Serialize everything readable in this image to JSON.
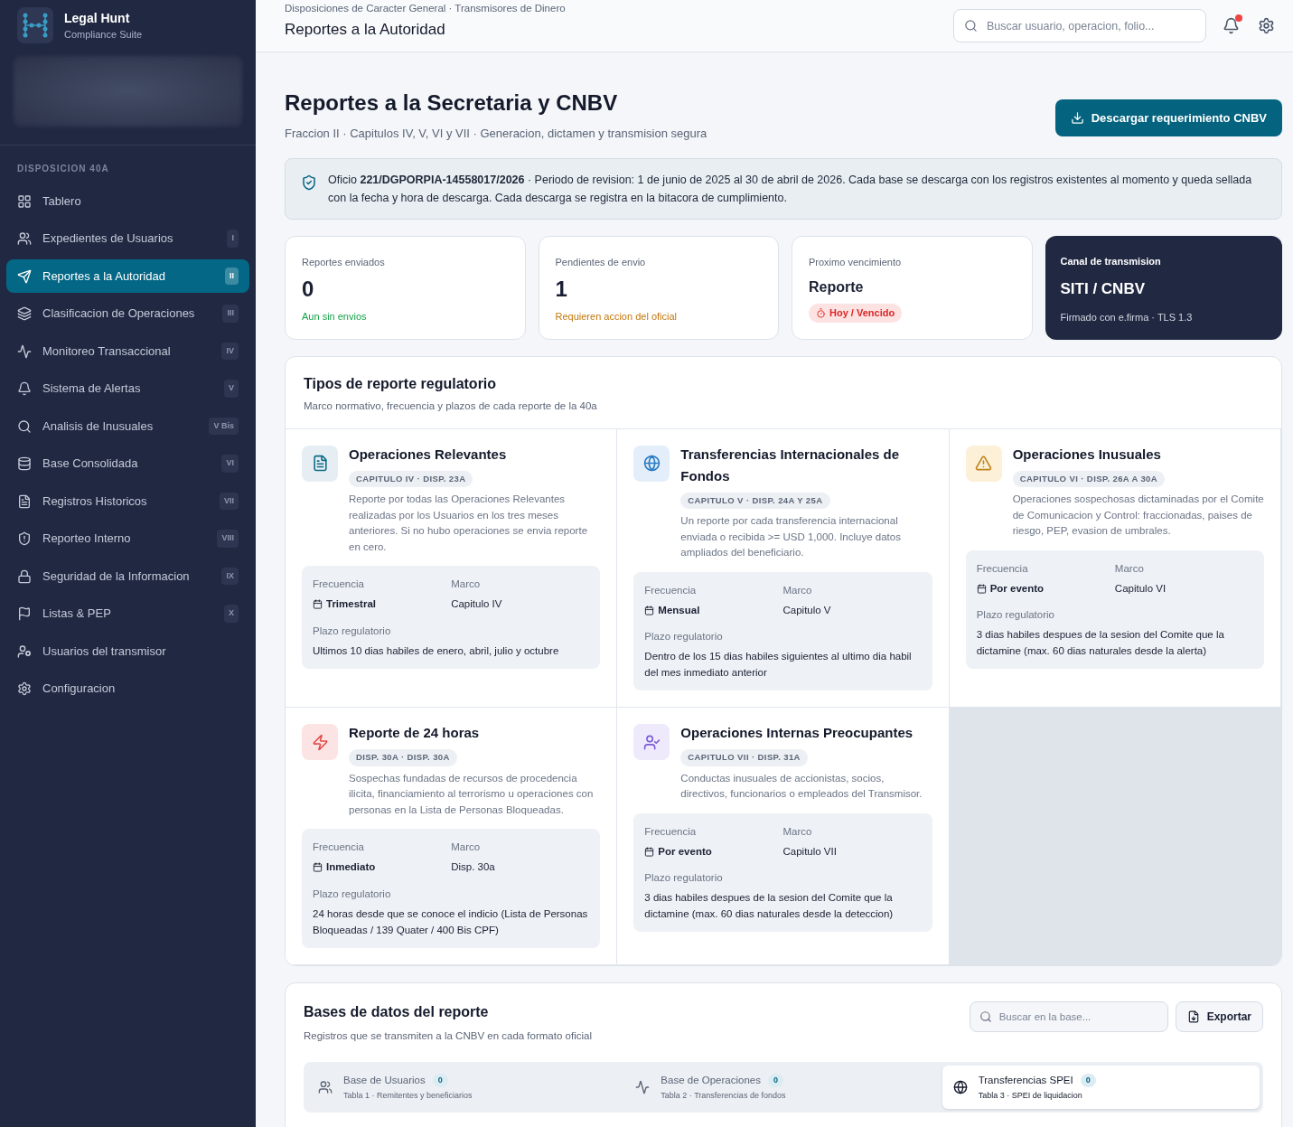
{
  "brand": {
    "name": "Legal Hunt",
    "subtitle": "Compliance Suite"
  },
  "sidebar": {
    "section": "DISPOSICION 40A",
    "items": [
      {
        "kind": "grid",
        "label": "Tablero",
        "selected": false
      },
      {
        "kind": "users",
        "label": "Expedientes de Usuarios",
        "badge": "I",
        "selected": false
      },
      {
        "kind": "send",
        "label": "Reportes a la Autoridad",
        "badge": "II",
        "selected": true
      },
      {
        "kind": "layers",
        "label": "Clasificacion de Operaciones",
        "badge": "III",
        "selected": false
      },
      {
        "kind": "pulse",
        "label": "Monitoreo Transaccional",
        "badge": "IV",
        "selected": false
      },
      {
        "kind": "bell",
        "label": "Sistema de Alertas",
        "badge": "V",
        "selected": false
      },
      {
        "kind": "search",
        "label": "Analisis de Inusuales",
        "badge": "V Bis",
        "selected": false
      },
      {
        "kind": "db",
        "label": "Base Consolidada",
        "badge": "VI",
        "selected": false
      },
      {
        "kind": "file",
        "label": "Registros Historicos",
        "badge": "VII",
        "selected": false
      },
      {
        "kind": "shield",
        "label": "Reporteo Interno",
        "badge": "VIII",
        "selected": false
      },
      {
        "kind": "lock",
        "label": "Seguridad de la Informacion",
        "badge": "IX",
        "selected": false
      },
      {
        "kind": "flag",
        "label": "Listas & PEP",
        "badge": "X",
        "selected": false
      },
      {
        "kind": "usercog",
        "label": "Usuarios del transmisor",
        "selected": false
      },
      {
        "kind": "gear",
        "label": "Configuracion",
        "selected": false
      }
    ]
  },
  "header": {
    "breadcrumb": "Disposiciones de Caracter General · Transmisores de Dinero",
    "title": "Reportes a la Autoridad",
    "search": {
      "placeholder": "Buscar usuario, operacion, folio..."
    },
    "notifications_unread": true
  },
  "page": {
    "title": "Reportes a la Secretaria y CNBV",
    "subtitle": "Fraccion II · Capitulos IV, V, VI y VII · Generacion, dictamen y transmision segura",
    "action": "Descargar requerimiento CNBV",
    "notice": "Oficio **221/DGPORPIA-14558017/2026** · Periodo de revision: 1 de junio de 2025 al 30 de abril de 2026. Cada base se descarga con los registros existentes al momento y queda sellada con la fecha y hora de descarga. Cada descarga se registra en la bitacora de cumplimiento."
  },
  "stats": [
    {
      "kind": "done",
      "label": "Reportes enviados",
      "value": "0",
      "note": "Aun sin envios"
    },
    {
      "kind": "pending",
      "label": "Pendientes de envio",
      "value": "1",
      "note": "Requieren accion del oficial"
    },
    {
      "kind": "due",
      "label": "Proximo vencimiento",
      "value": "Reporte",
      "badge": "Hoy / Vencido"
    },
    {
      "kind": "channel",
      "label": "Canal de transmision",
      "value": "SITI / CNBV",
      "note": "Firmado con e.firma · TLS 1.3"
    }
  ],
  "report_types": {
    "title": "Tipos de reporte regulatorio",
    "subtitle": "Marco normativo, frecuencia y plazos de cada reporte de la 40a",
    "items": [
      {
        "kind": "document",
        "color": "#0e6a86",
        "title": "Operaciones Relevantes",
        "tag": "CAPITULO IV · DISP. 23A",
        "description": "Reporte por todas las Operaciones Relevantes realizadas por los Usuarios en los tres meses anteriores. Si no hubo operaciones se envia reporte en cero.",
        "frequency_label": "Frecuencia",
        "framework_label": "Marco",
        "deadline_label": "Plazo regulatorio",
        "frequency": "Trimestral",
        "framework": "Capitulo IV",
        "deadline": "Ultimos 10 dias habiles de enero, abril, julio y octubre"
      },
      {
        "kind": "globe",
        "color": "#2b7bc4",
        "title": "Transferencias Internacionales de Fondos",
        "tag": "CAPITULO V · DISP. 24A Y 25A",
        "description": "Un reporte por cada transferencia internacional enviada o recibida >= USD 1,000. Incluye datos ampliados del beneficiario.",
        "frequency_label": "Frecuencia",
        "framework_label": "Marco",
        "deadline_label": "Plazo regulatorio",
        "frequency": "Mensual",
        "framework": "Capitulo V",
        "deadline": "Dentro de los 15 dias habiles siguientes al ultimo dia habil del mes inmediato anterior"
      },
      {
        "kind": "warning",
        "color": "#c0841a",
        "title": "Operaciones Inusuales",
        "tag": "CAPITULO VI · DISP. 26A A 30A",
        "description": "Operaciones sospechosas dictaminadas por el Comite de Comunicacion y Control: fraccionadas, paises de riesgo, PEP, evasion de umbrales.",
        "frequency_label": "Frecuencia",
        "framework_label": "Marco",
        "deadline_label": "Plazo regulatorio",
        "frequency": "Por evento",
        "framework": "Capitulo VI",
        "deadline": "3 dias habiles despues de la sesion del Comite que la dictamine (max. 60 dias naturales desde la alerta)"
      },
      {
        "kind": "bolt",
        "color": "#e04848",
        "title": "Reporte de 24 horas",
        "tag": "DISP. 30A · DISP. 30A",
        "description": "Sospechas fundadas de recursos de procedencia ilicita, financiamiento al terrorismo u operaciones con personas en la Lista de Personas Bloqueadas.",
        "frequency_label": "Frecuencia",
        "framework_label": "Marco",
        "deadline_label": "Plazo regulatorio",
        "frequency": "Inmediato",
        "framework": "Disp. 30a",
        "deadline": "24 horas desde que se conoce el indicio (Lista de Personas Bloqueadas / 139 Quater / 400 Bis CPF)"
      },
      {
        "kind": "usercheck",
        "color": "#7c5bd6",
        "title": "Operaciones Internas Preocupantes",
        "tag": "CAPITULO VII · DISP. 31A",
        "description": "Conductas inusuales de accionistas, socios, directivos, funcionarios o empleados del Transmisor.",
        "frequency_label": "Frecuencia",
        "framework_label": "Marco",
        "deadline_label": "Plazo regulatorio",
        "frequency": "Por evento",
        "framework": "Capitulo VII",
        "deadline": "3 dias habiles despues de la sesion del Comite que la dictamine (max. 60 dias naturales desde la deteccion)"
      }
    ]
  },
  "databases": {
    "title": "Bases de datos del reporte",
    "subtitle": "Registros que se transmiten a la CNBV en cada formato oficial",
    "search": {
      "placeholder": "Buscar en la base..."
    },
    "export": "Exportar",
    "tabs": [
      {
        "kind": "users",
        "label": "Base de Usuarios",
        "count": "0",
        "caption": "Tabla 1 · Remitentes y beneficiarios",
        "selected": false
      },
      {
        "kind": "pulse",
        "label": "Base de Operaciones",
        "count": "0",
        "caption": "Tabla 2 · Transferencias de fondos",
        "selected": false
      },
      {
        "kind": "globe",
        "label": "Transferencias SPEI",
        "count": "0",
        "caption": "Tabla 3 · SPEI de liquidacion",
        "selected": true
      }
    ]
  }
}
